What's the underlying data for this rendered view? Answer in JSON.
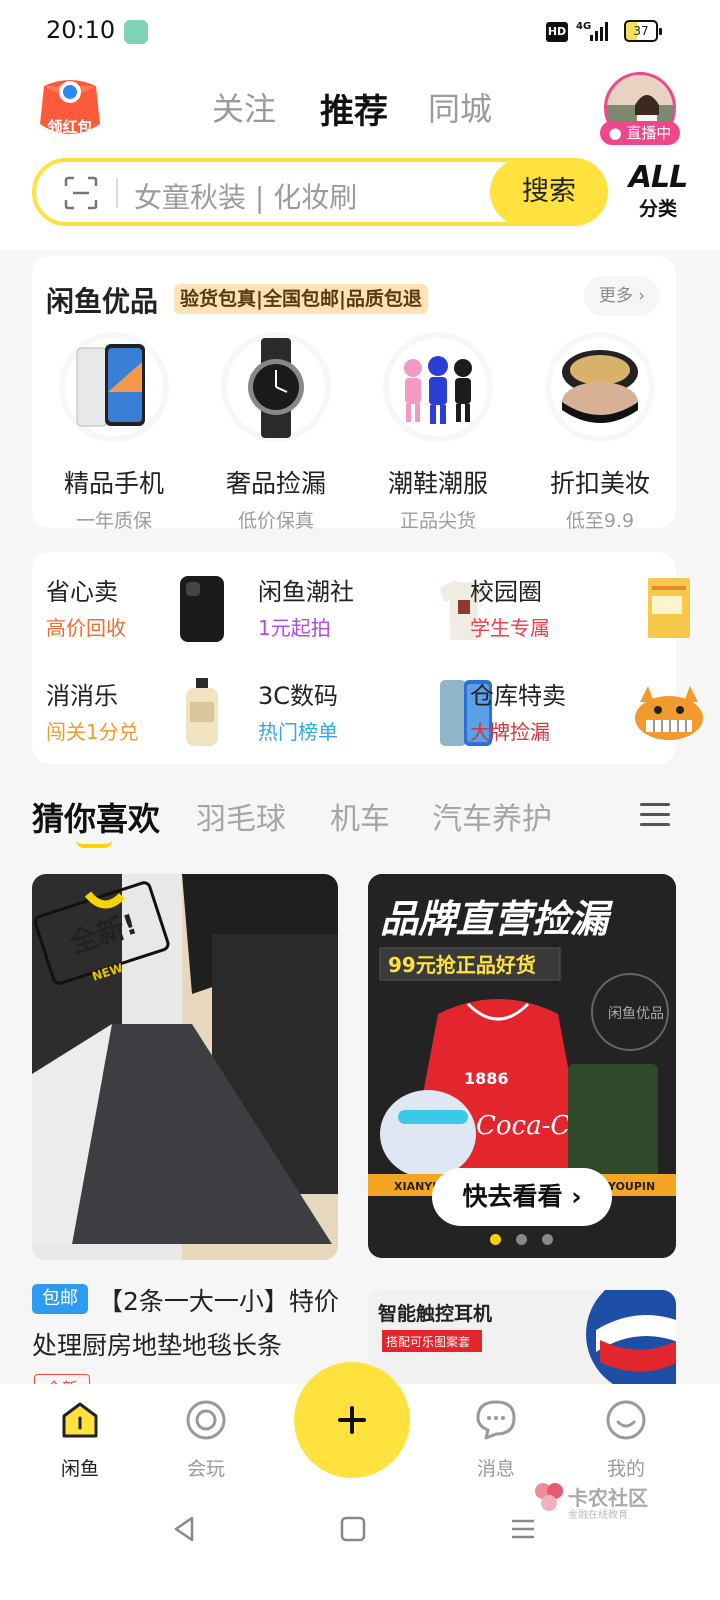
{
  "status_bar": {
    "time": "20:10",
    "hd": "HD",
    "network": "4G",
    "battery": "37"
  },
  "header": {
    "red_packet_label": "领红包",
    "tabs": [
      {
        "label": "关注"
      },
      {
        "label": "推荐"
      },
      {
        "label": "同城"
      }
    ],
    "live_badge": "直播中"
  },
  "search": {
    "placeholder": "女童秋装 | 化妆刷",
    "button": "搜索",
    "category_top": "ALL",
    "category_bottom": "分类"
  },
  "youpin": {
    "title": "闲鱼优品",
    "tags": "验货包真|全国包邮|品质包退",
    "more": "更多",
    "items": [
      {
        "name": "精品手机",
        "sub": "一年质保"
      },
      {
        "name": "奢品捡漏",
        "sub": "低价保真"
      },
      {
        "name": "潮鞋潮服",
        "sub": "正品尖货"
      },
      {
        "name": "折扣美妆",
        "sub": "低至9.9"
      }
    ]
  },
  "services": [
    {
      "title": "省心卖",
      "sub": "高价回收",
      "color": "#f26b2f"
    },
    {
      "title": "闲鱼潮社",
      "sub": "1元起拍",
      "color": "#b24be0"
    },
    {
      "title": "校园圈",
      "sub": "学生专属",
      "color": "#ef3e4a"
    },
    {
      "title": "消消乐",
      "sub": "闯关1分兑",
      "color": "#f29a2e"
    },
    {
      "title": "3C数码",
      "sub": "热门榜单",
      "color": "#33a7e2"
    },
    {
      "title": "仓库特卖",
      "sub": "大牌捡漏",
      "color": "#d8343a"
    }
  ],
  "feed_tabs": [
    {
      "label": "猜你喜欢"
    },
    {
      "label": "羽毛球"
    },
    {
      "label": "机车"
    },
    {
      "label": "汽车养护"
    }
  ],
  "feed": {
    "left_badge": "全新!",
    "left_badge_sub": "NEW",
    "left_item": {
      "tag": "包邮",
      "title": "【2条一大一小】特价处理厨房地垫地毯长条",
      "tag2": "全新"
    },
    "banner": {
      "headline": "品牌直营捡漏",
      "subline": "99元抢正品好货",
      "button": "快去看看",
      "footer_left": "XIANYU",
      "footer_right": "YOUPIN",
      "hoodie_text": "1886",
      "brand_text": "Coca-Cola",
      "stamp_top": "XIAN YU YOU PIN",
      "stamp_mid": "闲鱼优品",
      "active_dot": 0,
      "dot_count": 3
    },
    "second_banner": {
      "headline": "智能触控耳机",
      "subline": "搭配可乐图案套"
    }
  },
  "bottom_nav": [
    {
      "label": "闲鱼"
    },
    {
      "label": "会玩"
    },
    {
      "label": "消息"
    },
    {
      "label": "我的"
    }
  ],
  "watermark": {
    "text": "卡农社区",
    "sub": "金融在线教育"
  },
  "colors": {
    "accent_yellow": "#ffe23d",
    "pink_live": "#f0478b",
    "blue_tag": "#2d9bf0"
  }
}
